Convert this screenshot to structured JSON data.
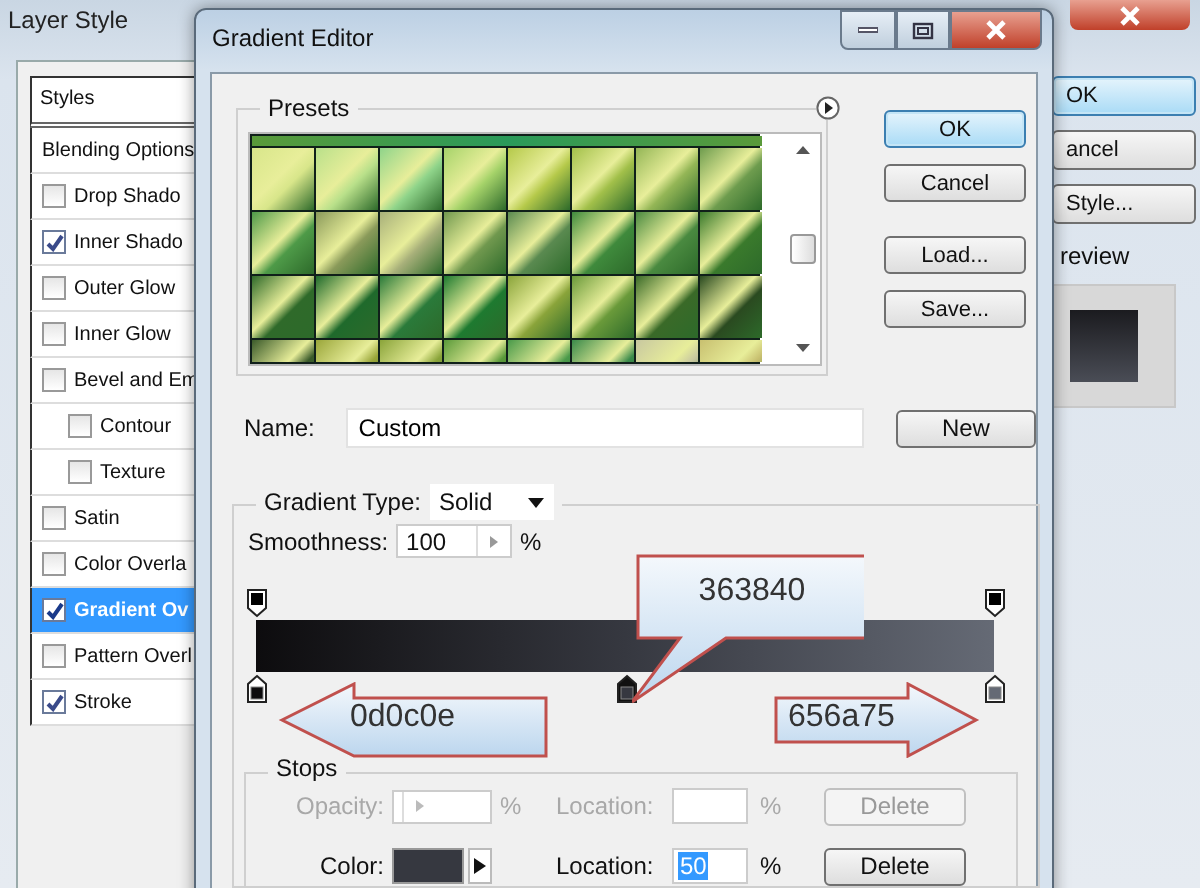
{
  "layer_style": {
    "title": "Layer Style",
    "styles_header": "Styles",
    "items": [
      {
        "label": "Blending Options",
        "kind": "header",
        "selected": false
      },
      {
        "label": "Drop Shado",
        "kind": "check",
        "checked": false,
        "selected": false
      },
      {
        "label": "Inner Shado",
        "kind": "check",
        "checked": true,
        "selected": false
      },
      {
        "label": "Outer Glow",
        "kind": "check",
        "checked": false,
        "selected": false
      },
      {
        "label": "Inner Glow",
        "kind": "check",
        "checked": false,
        "selected": false
      },
      {
        "label": "Bevel and Em",
        "kind": "check",
        "checked": false,
        "selected": false
      },
      {
        "label": "Contour",
        "kind": "subcheck",
        "checked": false,
        "selected": false
      },
      {
        "label": "Texture",
        "kind": "subcheck",
        "checked": false,
        "selected": false
      },
      {
        "label": "Satin",
        "kind": "check",
        "checked": false,
        "selected": false
      },
      {
        "label": "Color Overla",
        "kind": "check",
        "checked": false,
        "selected": false
      },
      {
        "label": "Gradient Ov",
        "kind": "check",
        "checked": true,
        "selected": true
      },
      {
        "label": "Pattern Overl",
        "kind": "check",
        "checked": false,
        "selected": false
      },
      {
        "label": "Stroke",
        "kind": "check",
        "checked": true,
        "selected": false
      }
    ],
    "buttons": [
      {
        "label": "OK",
        "default": true
      },
      {
        "label": "ancel",
        "default": false
      },
      {
        "label": "Style...",
        "default": false
      }
    ],
    "preview_label": "review"
  },
  "gradient_editor": {
    "title": "Gradient Editor",
    "presets_label": "Presets",
    "buttons": [
      {
        "label": "OK",
        "default": true
      },
      {
        "label": "Cancel",
        "default": false
      },
      {
        "label": "Load...",
        "default": false
      },
      {
        "label": "Save...",
        "default": false
      }
    ],
    "name": {
      "label": "Name:",
      "value": "Custom",
      "button": "New"
    },
    "gradient_type": {
      "label": "Gradient Type:",
      "value": "Solid"
    },
    "smoothness": {
      "label": "Smoothness:",
      "value": "100",
      "unit": "%"
    },
    "opacity_stops": [
      {
        "level": 0,
        "selected": false
      },
      {
        "level": 1,
        "selected": false
      }
    ],
    "color_stops": [
      {
        "level": 0,
        "color": "#0d0c0e",
        "selected": false
      },
      {
        "level": 0.5,
        "color": "#363840",
        "selected": true
      },
      {
        "level": 1,
        "color": "#656a75",
        "selected": false
      }
    ],
    "callouts": [
      {
        "text": "363840",
        "kind": "pointer-down"
      },
      {
        "text": "0d0c0e",
        "kind": "arrow-left"
      },
      {
        "text": "656a75",
        "kind": "arrow-right"
      }
    ],
    "stops": {
      "label": "Stops",
      "rows": [
        {
          "label": "Opacity:",
          "kind": "opacity",
          "unit": "%",
          "location_label": "Location:",
          "location_unit": "%",
          "button": "Delete",
          "disabled": true
        },
        {
          "label": "Color:",
          "kind": "color",
          "color": "#363840",
          "location_label": "Location:",
          "location_value": "50",
          "location_unit": "%",
          "button": "Delete",
          "disabled": false
        }
      ]
    }
  }
}
